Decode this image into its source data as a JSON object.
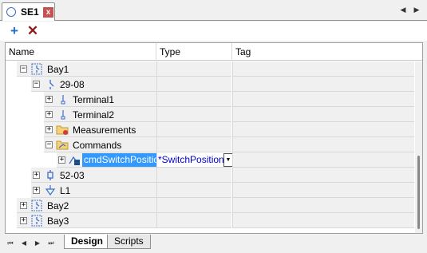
{
  "tab": {
    "title": "SE1",
    "close": "x"
  },
  "toolbar": {
    "add": "+",
    "delete": "✕"
  },
  "columns": [
    "Name",
    "Type",
    "Tag"
  ],
  "tree": {
    "bay1": "Bay1",
    "b2908": "29-08",
    "terminal1": "Terminal1",
    "terminal2": "Terminal2",
    "measurements": "Measurements",
    "commands": "Commands",
    "cmd": "cmdSwitchPosition",
    "cmd_type": "*SwitchPosition",
    "b5203": "52-03",
    "l1": "L1",
    "bay2": "Bay2",
    "bay3": "Bay3"
  },
  "expanders": {
    "plus": "+",
    "minus": "−"
  },
  "sheets": [
    "Design",
    "Scripts"
  ],
  "nav": {
    "first": "⏮",
    "prev": "◀",
    "next": "▶",
    "last": "⏭"
  }
}
